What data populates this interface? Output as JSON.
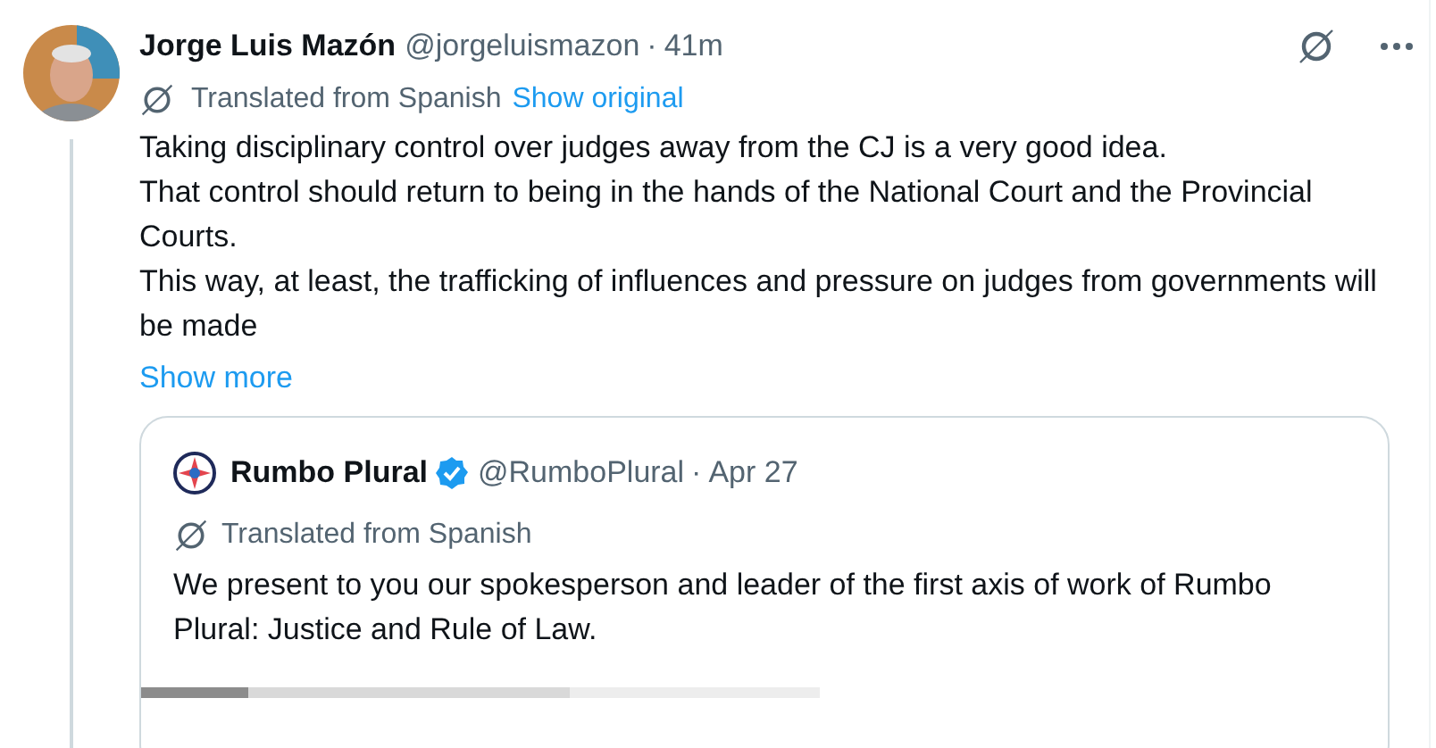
{
  "post": {
    "author": "Jorge Luis Mazón",
    "handle": "@jorgeluismazon",
    "separator": "·",
    "time": "41m",
    "translation_note": "Translated from Spanish",
    "show_original": "Show original",
    "paragraphs": [
      "Taking disciplinary control over judges away from the CJ is a very good idea.",
      "That control should return to being in the hands of the National Court and the Provincial Courts.",
      "This way, at least, the trafficking of influences and pressure on judges from governments will be made"
    ],
    "show_more": "Show more",
    "quote": {
      "author": "Rumbo Plural",
      "verified": true,
      "handle": "@RumboPlural",
      "separator": "·",
      "time": "Apr 27",
      "translation_note": "Translated from Spanish",
      "text": "We present to you our spokesperson and leader of the first axis of work of Rumbo Plural: Justice and Rule of Law."
    }
  }
}
